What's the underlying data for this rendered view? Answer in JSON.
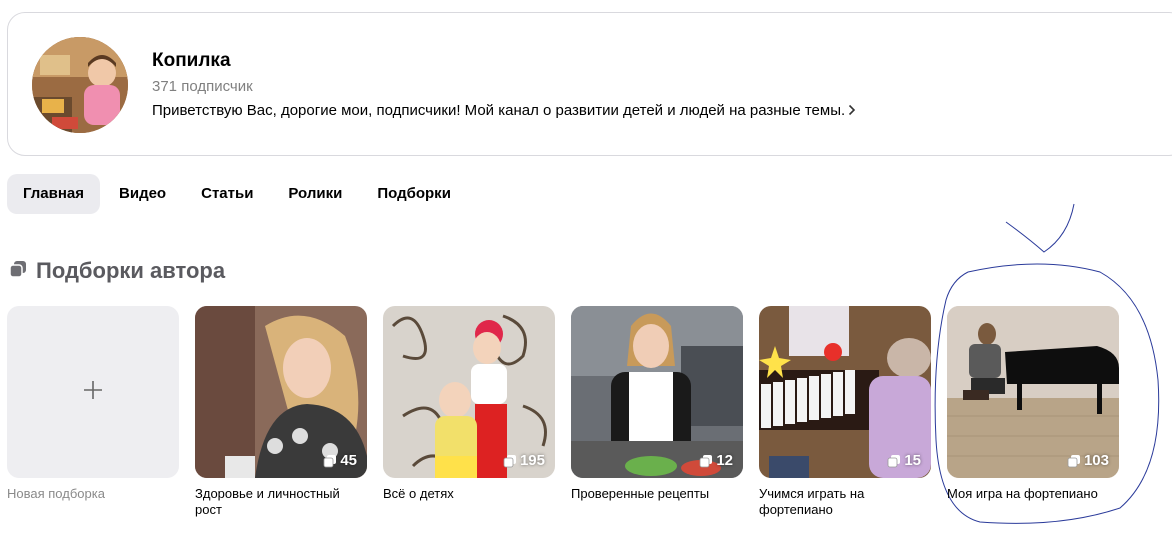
{
  "channel": {
    "name": "Копилка",
    "subscribers": "371 подписчик",
    "description": "Приветствую Вас, дорогие мои, подписчики! Мой канал о развитии детей и людей на разные темы."
  },
  "tabs": [
    "Главная",
    "Видео",
    "Статьи",
    "Ролики",
    "Подборки"
  ],
  "section": {
    "title": "Подборки автора"
  },
  "new_collection": {
    "label": "Новая подборка"
  },
  "collections": [
    {
      "label": "Здоровье и личностный рост",
      "count": "45"
    },
    {
      "label": "Всё о детях",
      "count": "195"
    },
    {
      "label": "Проверенные рецепты",
      "count": "12"
    },
    {
      "label": "Учимся играть на фортепиано",
      "count": "15"
    },
    {
      "label": "Моя игра на фортепиано",
      "count": "103"
    }
  ]
}
